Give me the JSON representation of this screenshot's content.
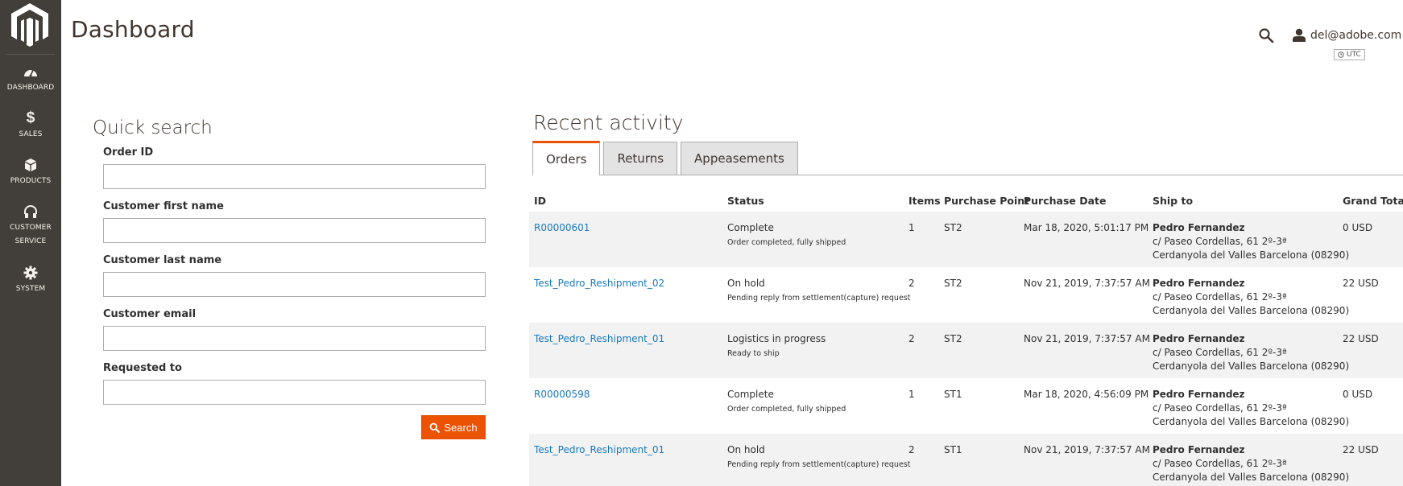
{
  "sidebar": {
    "items": [
      {
        "label": "DASHBOARD",
        "icon": "dashboard-icon"
      },
      {
        "label": "SALES",
        "icon": "dollar-icon",
        "glyph": "$"
      },
      {
        "label": "PRODUCTS",
        "icon": "box-icon"
      },
      {
        "label": "CUSTOMER",
        "label2": "SERVICE",
        "icon": "headset-icon"
      },
      {
        "label": "SYSTEM",
        "icon": "gear-icon"
      }
    ]
  },
  "header": {
    "title": "Dashboard",
    "user": "del@adobe.com",
    "timezone": "UTC"
  },
  "quick_search": {
    "title": "Quick search",
    "fields": [
      {
        "label": "Order ID",
        "value": "",
        "placeholder": ""
      },
      {
        "label": "Customer first name",
        "value": "",
        "placeholder": ""
      },
      {
        "label": "Customer last name",
        "value": "",
        "placeholder": ""
      },
      {
        "label": "Customer email",
        "value": "",
        "placeholder": ""
      },
      {
        "label": "Requested to",
        "value": "",
        "placeholder": ""
      }
    ],
    "search_label": "Search"
  },
  "recent_activity": {
    "title": "Recent activity",
    "tabs": [
      {
        "label": "Orders",
        "active": true
      },
      {
        "label": "Returns",
        "active": false
      },
      {
        "label": "Appeasements",
        "active": false
      }
    ],
    "columns": [
      "ID",
      "Status",
      "Items",
      "Purchase Point",
      "Purchase Date",
      "Ship to",
      "Grand Total"
    ],
    "rows": [
      {
        "id": "R00000601",
        "status": "Complete",
        "status_detail": "Order completed, fully shipped",
        "items": "1",
        "purchase_point": "ST2",
        "purchase_date": "Mar 18, 2020, 5:01:17 PM",
        "ship_name": "Pedro Fernandez",
        "ship_line1": "c/ Paseo Cordellas, 61 2º-3ª",
        "ship_line2": "Cerdanyola del Valles Barcelona (08290)",
        "total": "0 USD"
      },
      {
        "id": "Test_Pedro_Reshipment_02",
        "status": "On hold",
        "status_detail": "Pending reply from settlement(capture) request",
        "items": "2",
        "purchase_point": "ST2",
        "purchase_date": "Nov 21, 2019, 7:37:57 AM",
        "ship_name": "Pedro Fernandez",
        "ship_line1": "c/ Paseo Cordellas, 61 2º-3ª",
        "ship_line2": "Cerdanyola del Valles Barcelona (08290)",
        "total": "22 USD"
      },
      {
        "id": "Test_Pedro_Reshipment_01",
        "status": "Logistics in progress",
        "status_detail": "Ready to ship",
        "items": "2",
        "purchase_point": "ST2",
        "purchase_date": "Nov 21, 2019, 7:37:57 AM",
        "ship_name": "Pedro Fernandez",
        "ship_line1": "c/ Paseo Cordellas, 61 2º-3ª",
        "ship_line2": "Cerdanyola del Valles Barcelona (08290)",
        "total": "22 USD"
      },
      {
        "id": "R00000598",
        "status": "Complete",
        "status_detail": "Order completed, fully shipped",
        "items": "1",
        "purchase_point": "ST1",
        "purchase_date": "Mar 18, 2020, 4:56:09 PM",
        "ship_name": "Pedro Fernandez",
        "ship_line1": "c/ Paseo Cordellas, 61 2º-3ª",
        "ship_line2": "Cerdanyola del Valles Barcelona (08290)",
        "total": "0 USD"
      },
      {
        "id": "Test_Pedro_Reshipment_01",
        "status": "On hold",
        "status_detail": "Pending reply from settlement(capture) request",
        "items": "2",
        "purchase_point": "ST1",
        "purchase_date": "Nov 21, 2019, 7:37:57 AM",
        "ship_name": "Pedro Fernandez",
        "ship_line1": "c/ Paseo Cordellas, 61 2º-3ª",
        "ship_line2": "Cerdanyola del Valles Barcelona (08290)",
        "total": "22 USD"
      }
    ]
  },
  "colors": {
    "sidebar_bg": "#423f3a",
    "accent": "#eb5202",
    "link": "#1979c3",
    "row_alt": "#f2f2f2"
  }
}
